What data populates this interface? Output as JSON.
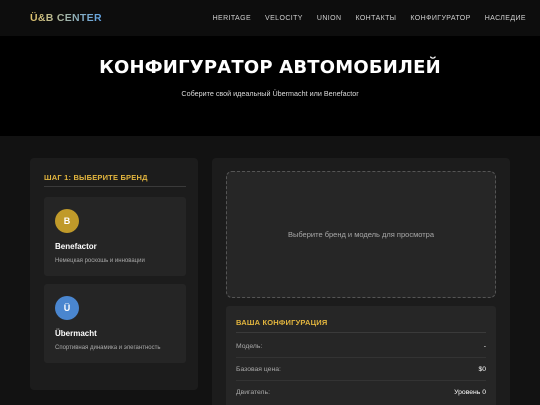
{
  "navbar": {
    "logo": "Ü&B CENTER",
    "links": [
      "HERITAGE",
      "VELOCITY",
      "UNION",
      "КОНТАКТЫ",
      "КОНФИГУРАТОР",
      "НАСЛЕДИЕ"
    ]
  },
  "hero": {
    "title": "КОНФИГУРАТОР АВТОМОБИЛЕЙ",
    "subtitle": "Соберите свой идеальный Übermacht или Benefactor"
  },
  "brand_step": {
    "title": "ШАГ 1: ВЫБЕРИТЕ БРЕНД",
    "brands": [
      {
        "badge": "B",
        "name": "Benefactor",
        "description": "Немецкая роскошь и инновации",
        "color": "#c09a2a"
      },
      {
        "badge": "Ü",
        "name": "Übermacht",
        "description": "Спортивная динамика и элегантность",
        "color": "#4a86cf"
      }
    ]
  },
  "preview": {
    "placeholder": "Выберите бренд и модель для просмотра"
  },
  "configuration": {
    "title": "ВАША КОНФИГУРАЦИЯ",
    "rows": [
      {
        "label": "Модель:",
        "value": "-"
      },
      {
        "label": "Базовая цена:",
        "value": "$0"
      },
      {
        "label": "Двигатель:",
        "value": "Уровень 0"
      }
    ]
  },
  "colors": {
    "accent": "#e2b53e",
    "background": "#121212",
    "panel": "#1c1c1c"
  }
}
